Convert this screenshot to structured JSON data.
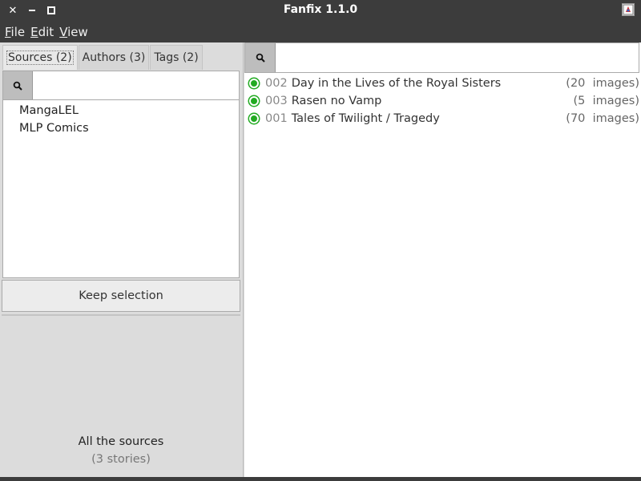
{
  "window": {
    "title": "Fanfix 1.1.0",
    "close_glyph": "✕"
  },
  "menu": [
    {
      "label_mnemonic": "F",
      "label_rest": "ile"
    },
    {
      "label_mnemonic": "E",
      "label_rest": "dit"
    },
    {
      "label_mnemonic": "V",
      "label_rest": "iew"
    }
  ],
  "left": {
    "tabs": [
      {
        "label": "Sources (2)",
        "active": true
      },
      {
        "label": "Authors (3)",
        "active": false
      },
      {
        "label": "Tags (2)",
        "active": false
      }
    ],
    "search": {
      "value": "",
      "placeholder": ""
    },
    "sources": [
      "MangaLEL",
      "MLP Comics"
    ],
    "keep_selection_label": "Keep selection",
    "summary_title": "All the sources",
    "summary_count": "(3  stories)"
  },
  "right": {
    "search": {
      "value": "",
      "placeholder": ""
    },
    "stories": [
      {
        "number": "002",
        "title": "Day in the Lives of the Royal Sisters",
        "meta": "(20  images)",
        "status_color": "#22aa22"
      },
      {
        "number": "003",
        "title": "Rasen no Vamp",
        "meta": "(5  images)",
        "status_color": "#22aa22"
      },
      {
        "number": "001",
        "title": "Tales of Twilight / Tragedy",
        "meta": "(70  images)",
        "status_color": "#22aa22"
      }
    ]
  },
  "icons": {
    "search": "search-icon",
    "close": "close-icon",
    "minimize": "minimize-icon",
    "maximize": "maximize-icon",
    "app": "app-icon"
  },
  "colors": {
    "titlebar_bg": "#3c3c3c",
    "status_ok": "#22aa22"
  }
}
